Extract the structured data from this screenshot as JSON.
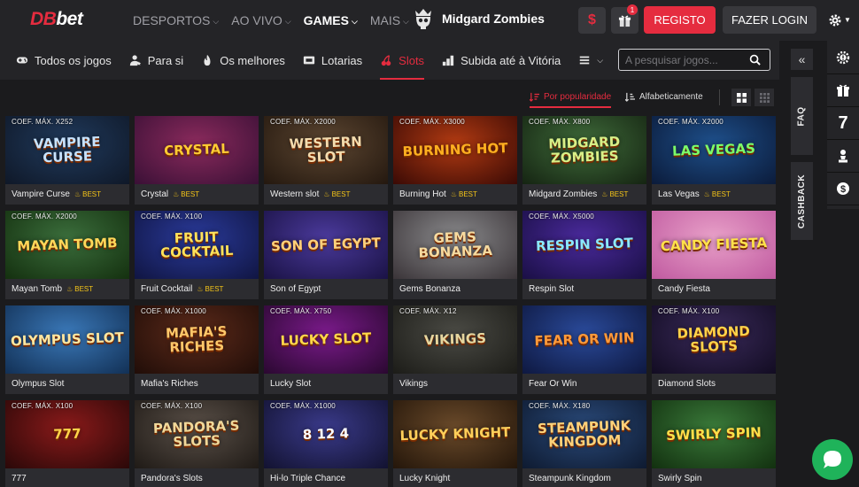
{
  "header": {
    "logo_db": "DB",
    "logo_bet": "bet",
    "nav": [
      {
        "label": "DESPORTOS",
        "active": false
      },
      {
        "label": "AO VIVO",
        "active": false
      },
      {
        "label": "GAMES",
        "active": true
      },
      {
        "label": "MAIS",
        "active": false
      }
    ],
    "feature_label": "Midgard Zombies",
    "dollar_symbol": "$",
    "gift_badge": "1",
    "register_label": "REGISTO",
    "login_label": "FAZER LOGIN"
  },
  "categories": [
    {
      "label": "Todos os jogos",
      "icon": "gamepad-icon",
      "active": false
    },
    {
      "label": "Para si",
      "icon": "user-star-icon",
      "active": false
    },
    {
      "label": "Os melhores",
      "icon": "flame-icon",
      "active": false
    },
    {
      "label": "Lotarias",
      "icon": "ticket-icon",
      "active": false
    },
    {
      "label": "Slots",
      "icon": "cherry-icon",
      "active": true
    },
    {
      "label": "Subida até à Vitória",
      "icon": "bars-icon",
      "active": false
    }
  ],
  "search": {
    "placeholder": "A pesquisar jogos..."
  },
  "sort": {
    "popular": "Por popularidade",
    "alpha": "Alfabeticamente"
  },
  "rail": {
    "toggle": "«",
    "faq": "FAQ",
    "cashback": "CASHBACK",
    "seven": "7"
  },
  "best_label": "BEST",
  "games": [
    {
      "name": "Vampire Curse",
      "coef": "COEF. MÁX. X252",
      "best": true,
      "art": "VAMPIRE CURSE",
      "c1": "#203a5c",
      "c2": "#0f1828",
      "ac": "#c7e3ff"
    },
    {
      "name": "Crystal",
      "coef": "",
      "best": true,
      "art": "CRYSTAL",
      "c1": "#8a2a5c",
      "c2": "#3a1036",
      "ac": "#ffcc33"
    },
    {
      "name": "Western slot",
      "coef": "COEF. MÁX. X2000",
      "best": true,
      "art": "WESTERN SLOT",
      "c1": "#5c4631",
      "c2": "#24180f",
      "ac": "#f3dcae"
    },
    {
      "name": "Burning Hot",
      "coef": "COEF. MÁX. X3000",
      "best": true,
      "art": "BURNING HOT",
      "c1": "#b13a12",
      "c2": "#3a0a05",
      "ac": "#ffb020"
    },
    {
      "name": "Midgard Zombies",
      "coef": "COEF. MÁX. X800",
      "best": true,
      "art": "MIDGARD ZOMBIES",
      "c1": "#3f6b3a",
      "c2": "#152412",
      "ac": "#d8f088"
    },
    {
      "name": "Las Vegas",
      "coef": "COEF. MÁX. X2000",
      "best": true,
      "art": "LAS VEGAS",
      "c1": "#1e4f8a",
      "c2": "#0b1b3a",
      "ac": "#7cff6a"
    },
    {
      "name": "Mayan Tomb",
      "coef": "COEF. MÁX. X2000",
      "best": true,
      "art": "MAYAN TOMB",
      "c1": "#3b6e3c",
      "c2": "#14300f",
      "ac": "#ffd85a"
    },
    {
      "name": "Fruit Cocktail",
      "coef": "COEF. MÁX. X100",
      "best": true,
      "art": "FRUIT COCKTAIL",
      "c1": "#2a3a9a",
      "c2": "#101542",
      "ac": "#ffe25a"
    },
    {
      "name": "Son of Egypt",
      "coef": "",
      "best": false,
      "art": "SON OF EGYPT",
      "c1": "#4b3a9c",
      "c2": "#1a1245",
      "ac": "#ffd07a"
    },
    {
      "name": "Gems Bonanza",
      "coef": "",
      "best": false,
      "art": "GEMS BONANZA",
      "c1": "#8a8a8c",
      "c2": "#3a3438",
      "ac": "#f6dba0"
    },
    {
      "name": "Respin Slot",
      "coef": "COEF. MÁX. X5000",
      "best": false,
      "art": "RESPIN SLOT",
      "c1": "#4a2a9c",
      "c2": "#1a0f45",
      "ac": "#8be9ff"
    },
    {
      "name": "Candy Fiesta",
      "coef": "",
      "best": false,
      "art": "CANDY FIESTA",
      "c1": "#e8a0c8",
      "c2": "#c05aa0",
      "ac": "#ffe24a"
    },
    {
      "name": "Olympus Slot",
      "coef": "",
      "best": false,
      "art": "OLYMPUS SLOT",
      "c1": "#3a78b8",
      "c2": "#123055",
      "ac": "#ffe7a0"
    },
    {
      "name": "Mafia's Riches",
      "coef": "COEF. MÁX. X1000",
      "best": false,
      "art": "MAFIA'S RICHES",
      "c1": "#5c2a1a",
      "c2": "#200d08",
      "ac": "#ffc86a"
    },
    {
      "name": "Lucky Slot",
      "coef": "COEF. MÁX. X750",
      "best": false,
      "art": "LUCKY SLOT",
      "c1": "#7a1a8a",
      "c2": "#2a0830",
      "ac": "#ffd84a"
    },
    {
      "name": "Vikings",
      "coef": "COEF. MÁX. X12",
      "best": false,
      "art": "VIKINGS",
      "c1": "#4a4a44",
      "c2": "#1c1c18",
      "ac": "#e6d7a0"
    },
    {
      "name": "Fear Or Win",
      "coef": "",
      "best": false,
      "art": "FEAR OR WIN",
      "c1": "#2a4a9a",
      "c2": "#0e1840",
      "ac": "#ff9a3a"
    },
    {
      "name": "Diamond Slots",
      "coef": "COEF. MÁX. X100",
      "best": false,
      "art": "DIAMOND SLOTS",
      "c1": "#3a2a5a",
      "c2": "#120c22",
      "ac": "#ffd34a"
    },
    {
      "name": "777",
      "coef": "COEF. MÁX. X100",
      "best": false,
      "art": "777",
      "c1": "#8a1a1a",
      "c2": "#2a0808",
      "ac": "#ffd34a"
    },
    {
      "name": "Pandora's Slots",
      "coef": "COEF. MÁX. X100",
      "best": false,
      "art": "PANDORA'S SLOTS",
      "c1": "#5a5048",
      "c2": "#1f1a16",
      "ac": "#f0d89a"
    },
    {
      "name": "Hi-lo Triple Chance",
      "coef": "COEF. MÁX. X1000",
      "best": false,
      "art": "8 12 4",
      "c1": "#3a3a8a",
      "c2": "#121230",
      "ac": "#ffffff"
    },
    {
      "name": "Lucky Knight",
      "coef": "",
      "best": false,
      "art": "LUCKY KNIGHT",
      "c1": "#6a4a2a",
      "c2": "#24160a",
      "ac": "#ffcf5a"
    },
    {
      "name": "Steampunk Kingdom",
      "coef": "COEF. MÁX. X180",
      "best": false,
      "art": "STEAMPUNK KINGDOM",
      "c1": "#2a4a7a",
      "c2": "#0e1a30",
      "ac": "#ffd27a"
    },
    {
      "name": "Swirly Spin",
      "coef": "",
      "best": false,
      "art": "SWIRLY SPIN",
      "c1": "#3a7a3a",
      "c2": "#12300f",
      "ac": "#ffe04a"
    }
  ]
}
